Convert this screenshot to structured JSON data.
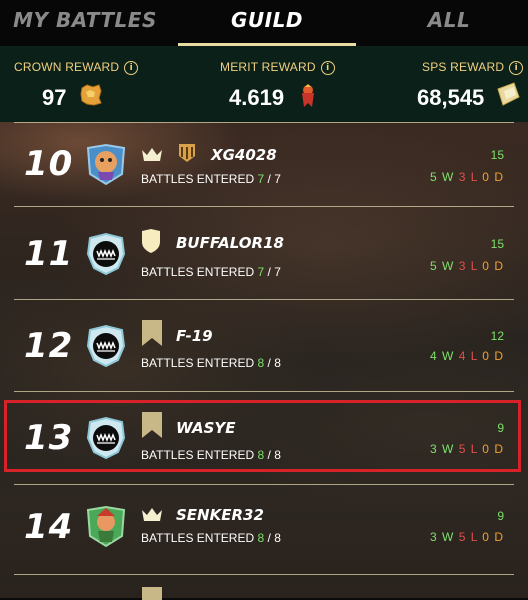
{
  "tabs": [
    {
      "label": "MY BATTLES"
    },
    {
      "label": "GUILD"
    },
    {
      "label": "ALL"
    }
  ],
  "rewards": [
    {
      "label": "CROWN REWARD",
      "value": "97",
      "icon": "crown-token-icon"
    },
    {
      "label": "MERIT REWARD",
      "value": "4.619",
      "icon": "merit-icon"
    },
    {
      "label": "SPS REWARD",
      "value": "68,545",
      "icon": "sps-token-icon"
    }
  ],
  "info_glyph": "i",
  "battles_label": "BATTLES ENTERED",
  "rows": [
    {
      "rank": "10",
      "player": "XG4028",
      "entered": "7",
      "total": "7",
      "score": "15",
      "wins": "5",
      "losses": "3",
      "draws": "0",
      "w": "W",
      "l": "L",
      "d": "D",
      "badges": [
        "crown-icon",
        "guild-banner-icon"
      ]
    },
    {
      "rank": "11",
      "player": "BUFFALOR18",
      "entered": "7",
      "total": "7",
      "score": "15",
      "wins": "5",
      "losses": "3",
      "draws": "0",
      "w": "W",
      "l": "L",
      "d": "D",
      "badges": [
        "shield-icon"
      ]
    },
    {
      "rank": "12",
      "player": "F-19",
      "entered": "8",
      "total": "8",
      "score": "12",
      "wins": "4",
      "losses": "4",
      "draws": "0",
      "w": "W",
      "l": "L",
      "d": "D",
      "badges": [
        "bookmark-icon"
      ]
    },
    {
      "rank": "13",
      "player": "WASYE",
      "entered": "8",
      "total": "8",
      "score": "9",
      "wins": "3",
      "losses": "5",
      "draws": "0",
      "w": "W",
      "l": "L",
      "d": "D",
      "badges": [
        "bookmark-icon"
      ]
    },
    {
      "rank": "14",
      "player": "SENKER32",
      "entered": "8",
      "total": "8",
      "score": "9",
      "wins": "3",
      "losses": "5",
      "draws": "0",
      "w": "W",
      "l": "L",
      "d": "D",
      "badges": [
        "crown-icon"
      ]
    }
  ],
  "colors": {
    "accent": "#e9dca2",
    "win": "#7ee06a",
    "loss": "#e0504a",
    "draw": "#f0a030",
    "highlight": "#d8222a"
  }
}
